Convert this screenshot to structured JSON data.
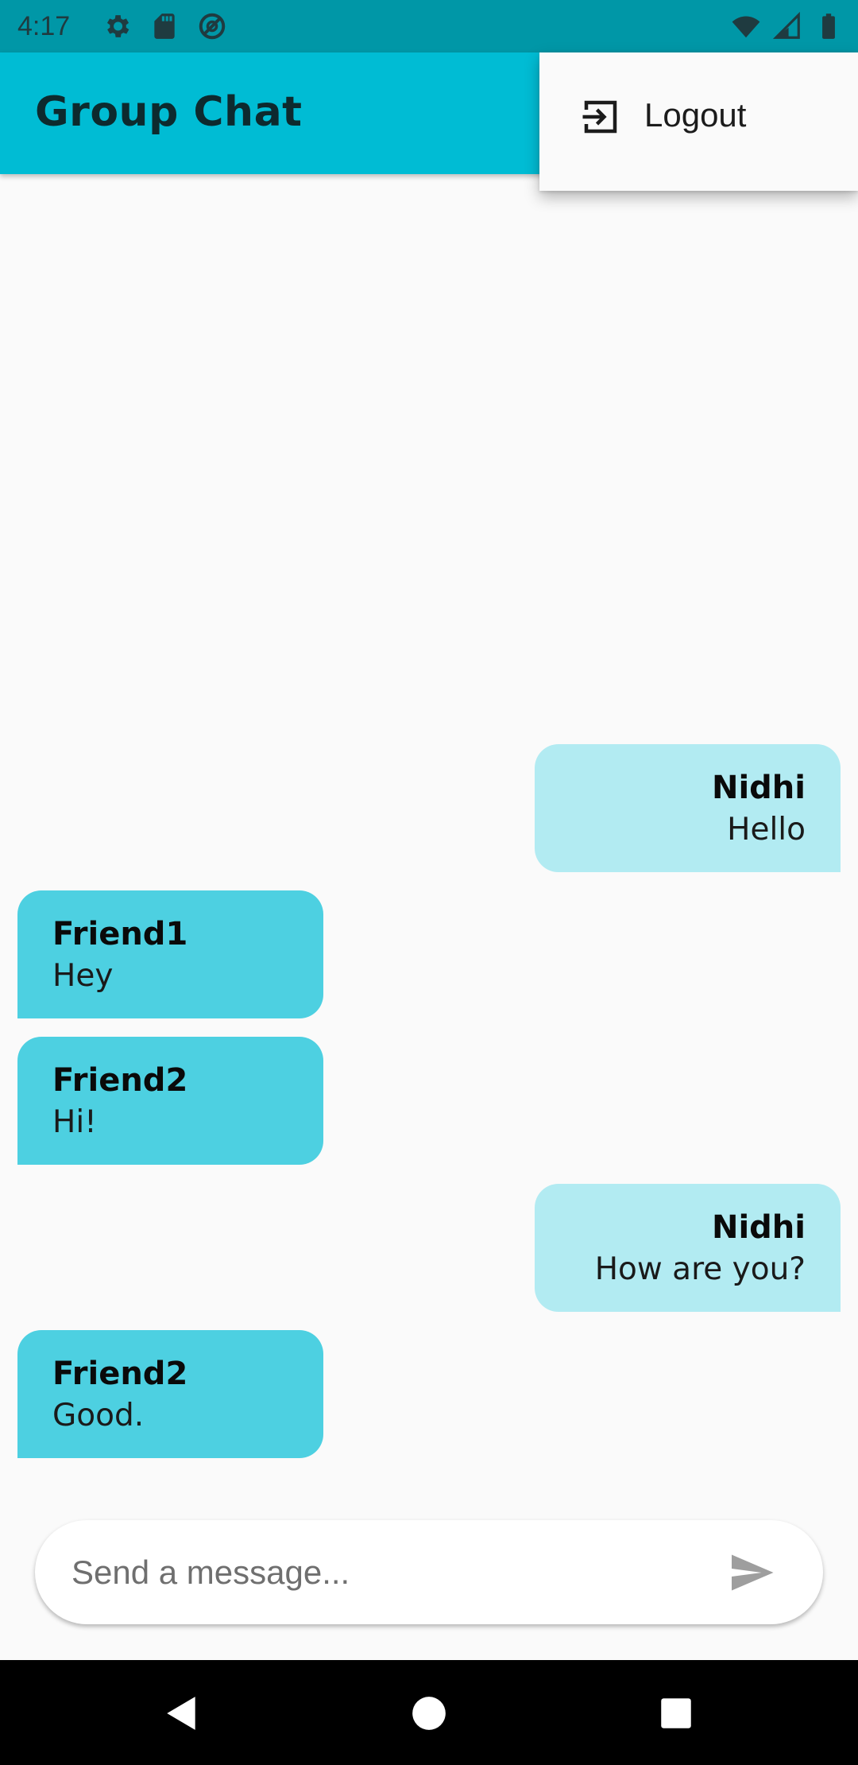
{
  "status_bar": {
    "time": "4:17",
    "left_icons": [
      "settings-icon",
      "sd-card-icon",
      "data-saver-icon"
    ],
    "right_icons": [
      "wifi-icon",
      "cell-signal-icon",
      "battery-icon"
    ]
  },
  "app_bar": {
    "title": "Group Chat",
    "color": "#00bcd4"
  },
  "menu": {
    "items": [
      {
        "label": "Logout",
        "icon": "logout-icon"
      }
    ]
  },
  "messages": [
    {
      "sender": "Nidhi",
      "text": "Hello",
      "mine": true
    },
    {
      "sender": "Friend1",
      "text": "Hey",
      "mine": false
    },
    {
      "sender": "Friend2",
      "text": "Hi!",
      "mine": false
    },
    {
      "sender": "Nidhi",
      "text": "How are you?",
      "mine": true
    },
    {
      "sender": "Friend2",
      "text": "Good.",
      "mine": false
    }
  ],
  "colors": {
    "mine_bubble": "#b2ebf2",
    "their_bubble": "#4dd0e1",
    "status_bar": "#0097a7"
  },
  "composer": {
    "placeholder": "Send a message...",
    "value": "",
    "send_icon": "send-icon"
  },
  "nav_bar": {
    "buttons": [
      "back-icon",
      "home-icon",
      "recents-icon"
    ]
  }
}
